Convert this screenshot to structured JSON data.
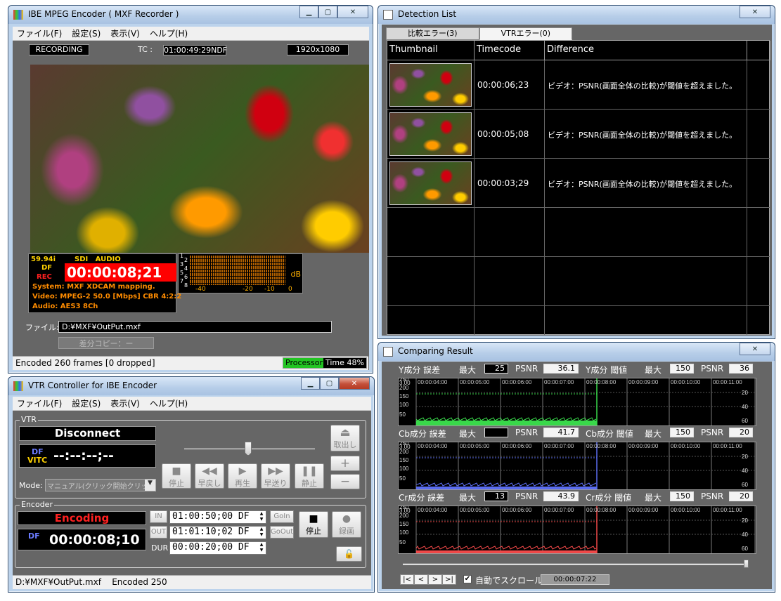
{
  "encoder": {
    "title": "IBE MPEG Encoder ( MXF Recorder )",
    "menu": [
      "ファイル(F)",
      "設定(S)",
      "表示(V)",
      "ヘルプ(H)"
    ],
    "status_lcd": "RECORDING",
    "tc_label": "TC :",
    "tc_value": "01:00:49:29NDF",
    "resolution": "1920x1080",
    "info": {
      "fps": "59.94i",
      "df": "DF",
      "rec": "REC",
      "sources": "SDI   AUDIO",
      "timecode": "00:00:08;21",
      "system": "System: MXF XDCAM mapping.",
      "video": "Video: MPEG-2 50.0 [Mbps] CBR 4:2:2",
      "audio": "Audio: AES3 8Ch"
    },
    "meter": {
      "channels": [
        "1",
        "2",
        "3",
        "4",
        "5",
        "6",
        "7",
        "8"
      ],
      "db_label": "dB",
      "scale": [
        "-40",
        "-20",
        "-10",
        "0"
      ]
    },
    "file_label": "ファイル:",
    "file_value": "D:¥MXF¥OutPut.mxf",
    "diff_copy_button": "差分コピー：ー",
    "statusbar_text": "Encoded 260 frames [0 dropped]",
    "processor_label": "Processor",
    "time_label": "Time",
    "time_value": "48%",
    "processor_progress": 0.48
  },
  "vtr": {
    "title": "VTR Controller for IBE Encoder",
    "menu": [
      "ファイル(F)",
      "設定(S)",
      "表示(V)",
      "ヘルプ(H)"
    ],
    "group_vtr": "VTR",
    "connection_status": "Disconnect",
    "df": "DF",
    "vitc": "VITC",
    "vtr_tc": "--:--:--;--",
    "mode_label": "Mode:",
    "mode_value": "マニュアル(クリック開始クリック終了",
    "buttons": {
      "stop": "停止",
      "rewind": "早戻し",
      "play": "再生",
      "fastforward": "早送り",
      "still": "静止",
      "eject": "取出し"
    },
    "plus": "+",
    "minus": "−",
    "group_encoder": "Encoder",
    "encoding_status": "Encoding",
    "enc_df": "DF",
    "enc_tc": "00:00:08;10",
    "in_label": "IN",
    "out_label": "OUT",
    "dur_label": "DUR",
    "in_tc": "01:00:50;00 DF",
    "out_tc": "01:01:10;02 DF",
    "dur_tc": "00:00:20;00 DF",
    "goin": "GoIn",
    "goout": "GoOut",
    "enc_stop": "停止",
    "enc_record": "録画",
    "statusbar_text": "D:¥MXF¥OutPut.mxf    Encoded 250"
  },
  "detection": {
    "title": "Detection List",
    "tabs": [
      "比較エラー(3)",
      "VTRエラー(0)"
    ],
    "columns": [
      "Thumbnail",
      "Timecode",
      "Difference"
    ],
    "rows": [
      {
        "timecode": "00:00:06;23",
        "difference": "ビデオ：PSNR(画面全体の比較)が閾値を超えました。"
      },
      {
        "timecode": "00:00:05;08",
        "difference": "ビデオ：PSNR(画面全体の比較)が閾値を超えました。"
      },
      {
        "timecode": "00:00:03;29",
        "difference": "ビデオ：PSNR(画面全体の比較)が閾値を超えました。"
      }
    ]
  },
  "comparing": {
    "title": "Comparing Result",
    "max_label": "最大",
    "psnr_label": "PSNR",
    "threshold_suffix": "閾値",
    "rows": [
      {
        "error_label": "Y成分 誤差",
        "max": "25",
        "psnr": "36.1",
        "thr_label": "Y成分 閾値",
        "thr_max": "150",
        "thr_psnr": "36",
        "color": "#39d84a"
      },
      {
        "error_label": "Cb成分 誤差",
        "max": "",
        "psnr": "41.7",
        "thr_label": "Cb成分 閾値",
        "thr_max": "150",
        "thr_psnr": "20",
        "color": "#5a6cf0"
      },
      {
        "error_label": "Cr成分 誤差",
        "max": "13",
        "psnr": "43.9",
        "thr_label": "Cr成分 閾値",
        "thr_max": "150",
        "thr_psnr": "20",
        "color": "#f04848"
      }
    ],
    "time_ticks": [
      "00:00:04:00",
      "00:00:05:00",
      "00:00:06:00",
      "00:00:07:00",
      "00:00:08:00",
      "00:00:09:00",
      "00:00:10:00",
      "00:00:11:00"
    ],
    "y_ticks_left": [
      "3.00",
      "250",
      "200",
      "150",
      "100",
      "50"
    ],
    "y_ticks_right": [
      "20",
      "40",
      "60"
    ],
    "nav": [
      "|<",
      "<",
      ">",
      ">|"
    ],
    "autoscroll_label": "自動でスクロール",
    "autoscroll_checked": true,
    "current_time": "00:00:07:22"
  }
}
